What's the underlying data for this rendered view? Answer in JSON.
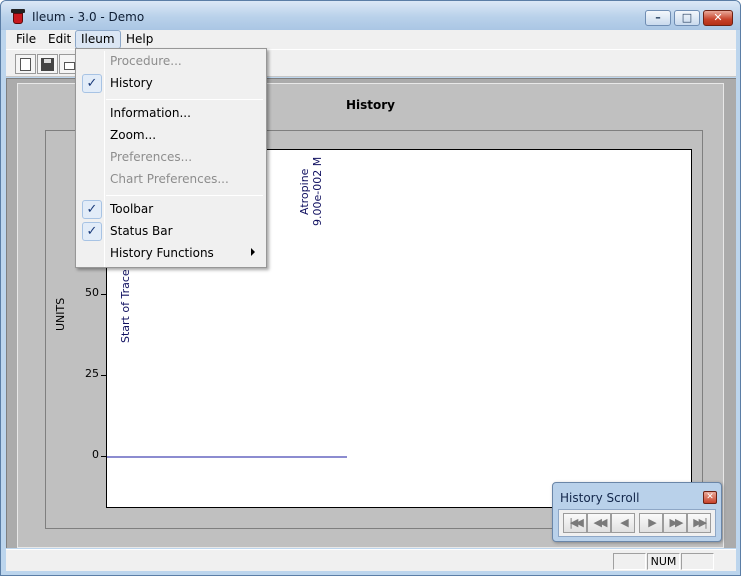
{
  "window": {
    "title": "Ileum - 3.0 - Demo",
    "minimize_glyph": "–",
    "maximize_glyph": "□",
    "close_glyph": "✕"
  },
  "menubar": {
    "items": [
      "File",
      "Edit",
      "Ileum",
      "Help"
    ],
    "open_menu": "Ileum"
  },
  "toolbar": {
    "icons": [
      "new-file-icon",
      "save-icon",
      "print-icon"
    ]
  },
  "ileum_menu": {
    "items": [
      {
        "label": "Procedure...",
        "enabled": false,
        "checked": false
      },
      {
        "label": "History",
        "enabled": true,
        "checked": true
      },
      {
        "label": "Information...",
        "enabled": true,
        "checked": false
      },
      {
        "label": "Zoom...",
        "enabled": true,
        "checked": false
      },
      {
        "label": "Preferences...",
        "enabled": false,
        "checked": false
      },
      {
        "label": "Chart Preferences...",
        "enabled": false,
        "checked": false
      },
      {
        "label": "Toolbar",
        "enabled": true,
        "checked": true
      },
      {
        "label": "Status Bar",
        "enabled": true,
        "checked": true
      },
      {
        "label": "History Functions",
        "enabled": true,
        "checked": false,
        "submenu": true
      }
    ],
    "check_glyph": "✓"
  },
  "chart": {
    "title": "History",
    "ylabel": "UNITS",
    "yticks": [
      "0",
      "25",
      "50"
    ],
    "annotation_trace": "Start of Trace - Co",
    "annotation_drug": "Atropine",
    "annotation_dose": "9.00e-002 M"
  },
  "chart_data": {
    "type": "line",
    "title": "History",
    "ylabel": "UNITS",
    "xlabel": "",
    "yticks": [
      0,
      25,
      50
    ],
    "series": [
      {
        "values": [
          0,
          0
        ],
        "x_fraction": [
          0.0,
          0.41
        ]
      }
    ],
    "annotations": [
      "Start of Trace - Co",
      "Atropine 9.00e-002 M"
    ],
    "color": "#1a1aa0"
  },
  "history_scroll": {
    "title": "History Scroll",
    "close_glyph": "✕",
    "buttons": [
      {
        "name": "first-icon",
        "glyph": "|◀◀"
      },
      {
        "name": "rewind-icon",
        "glyph": "◀◀"
      },
      {
        "name": "step-back-icon",
        "glyph": "◀"
      },
      {
        "name": "step-forward-icon",
        "glyph": "▶"
      },
      {
        "name": "fast-forward-icon",
        "glyph": "▶▶"
      },
      {
        "name": "last-icon",
        "glyph": "▶▶|"
      }
    ]
  },
  "statusbar": {
    "panes": [
      "",
      "NUM",
      ""
    ]
  }
}
